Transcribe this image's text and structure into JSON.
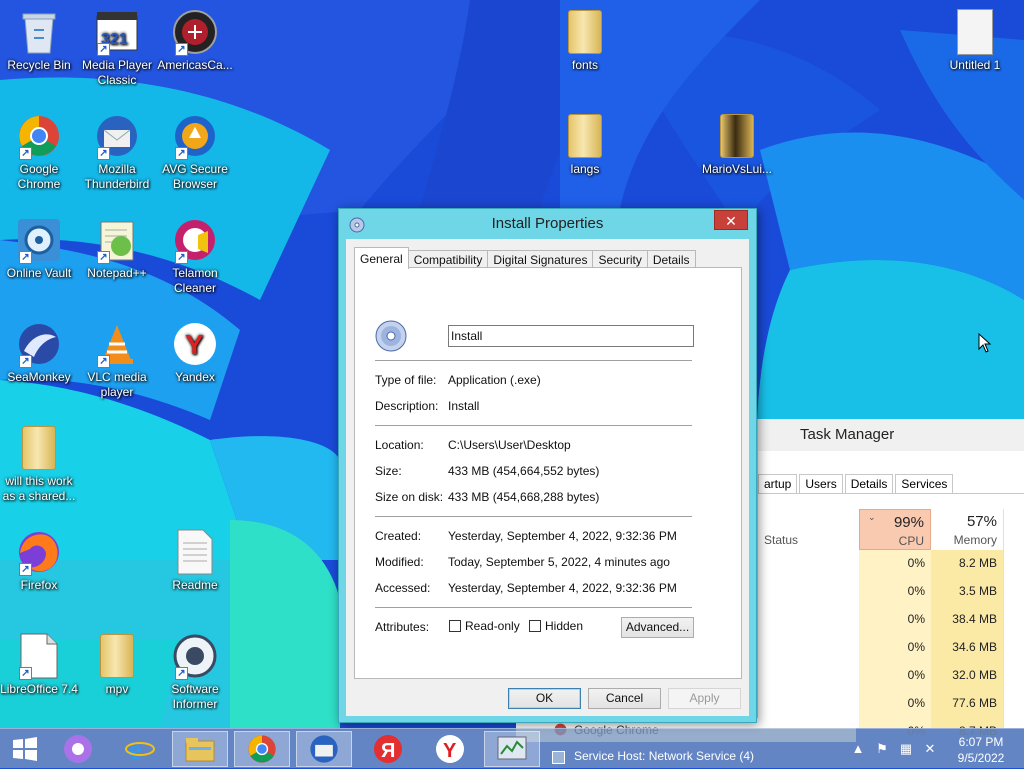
{
  "desktop": {
    "icons": [
      {
        "label": "Recycle Bin",
        "icon": "recycle-bin-icon"
      },
      {
        "label": "Media Player Classic",
        "icon": "media-player-classic-icon"
      },
      {
        "label": "AmericasCa...",
        "icon": "americas-cardroom-icon"
      },
      {
        "label": "fonts",
        "icon": "folder-icon"
      },
      {
        "label": "Untitled 1",
        "icon": "document-icon"
      },
      {
        "label": "Google Chrome",
        "icon": "chrome-icon"
      },
      {
        "label": "Mozilla Thunderbird",
        "icon": "thunderbird-icon"
      },
      {
        "label": "AVG Secure Browser",
        "icon": "avg-browser-icon"
      },
      {
        "label": "langs",
        "icon": "folder-icon"
      },
      {
        "label": "MarioVsLui...",
        "icon": "folder-icon"
      },
      {
        "label": "Online Vault",
        "icon": "online-vault-icon"
      },
      {
        "label": "Notepad++",
        "icon": "notepad-plus-plus-icon"
      },
      {
        "label": "Telamon Cleaner",
        "icon": "telamon-cleaner-icon"
      },
      {
        "label": "SeaMonkey",
        "icon": "seamonkey-icon"
      },
      {
        "label": "VLC media player",
        "icon": "vlc-icon"
      },
      {
        "label": "Yandex",
        "icon": "yandex-icon"
      },
      {
        "label": "will this work as a shared...",
        "icon": "folder-icon"
      },
      {
        "label": "Firefox",
        "icon": "firefox-icon"
      },
      {
        "label": "Readme",
        "icon": "document-icon"
      },
      {
        "label": "LibreOffice 7.4",
        "icon": "libreoffice-icon"
      },
      {
        "label": "mpv",
        "icon": "folder-icon"
      },
      {
        "label": "Software Informer",
        "icon": "software-informer-icon"
      }
    ]
  },
  "dialog": {
    "title": "Install Properties",
    "close": "✕",
    "tabs": [
      "General",
      "Compatibility",
      "Digital Signatures",
      "Security",
      "Details"
    ],
    "active_tab": "General",
    "name_value": "Install",
    "fields": {
      "type_label": "Type of file:",
      "type_value": "Application (.exe)",
      "desc_label": "Description:",
      "desc_value": "Install",
      "loc_label": "Location:",
      "loc_value": "C:\\Users\\User\\Desktop",
      "size_label": "Size:",
      "size_value": "433 MB (454,664,552 bytes)",
      "disk_label": "Size on disk:",
      "disk_value": "433 MB (454,668,288 bytes)",
      "created_label": "Created:",
      "created_value": "Yesterday, September 4, 2022, 9:32:36 PM",
      "modified_label": "Modified:",
      "modified_value": "Today, September 5, 2022, 4 minutes ago",
      "accessed_label": "Accessed:",
      "accessed_value": "Yesterday, September 4, 2022, 9:32:36 PM",
      "attr_label": "Attributes:",
      "readonly_label": "Read-only",
      "hidden_label": "Hidden"
    },
    "buttons": {
      "advanced": "Advanced...",
      "ok": "OK",
      "cancel": "Cancel",
      "apply": "Apply"
    }
  },
  "task_manager": {
    "title": "Task Manager",
    "tabs": [
      "artup",
      "Users",
      "Details",
      "Services"
    ],
    "status_header": "Status",
    "cpu_pct": "99%",
    "cpu_label": "CPU",
    "mem_pct": "57%",
    "mem_label": "Memory",
    "rows": [
      {
        "cpu": "0%",
        "mem": "8.2 MB"
      },
      {
        "cpu": "0%",
        "mem": "3.5 MB"
      },
      {
        "cpu": "0%",
        "mem": "38.4 MB"
      },
      {
        "cpu": "0%",
        "mem": "34.6 MB"
      },
      {
        "cpu": "0%",
        "mem": "32.0 MB"
      },
      {
        "cpu": "0%",
        "mem": "77.6 MB"
      },
      {
        "cpu": "0%",
        "mem": "8.7 MB"
      }
    ],
    "processes": [
      "Google Chrome",
      "Service Host: Network Service (4)"
    ]
  },
  "taskbar": {
    "items": [
      "start-icon",
      "cortana-icon",
      "internet-explorer-icon",
      "file-explorer-icon",
      "chrome-icon",
      "thunderbird-icon",
      "yandex-browser-icon",
      "yandex-icon",
      "task-manager-icon"
    ],
    "clock_time": "6:07 PM",
    "clock_date": "9/5/2022"
  },
  "colors": {
    "dialog_frame": "#6ed6e6",
    "close_button": "#c7413a",
    "cpu_header": "#f9c9b0",
    "memory_col": "#fbe9a6"
  }
}
